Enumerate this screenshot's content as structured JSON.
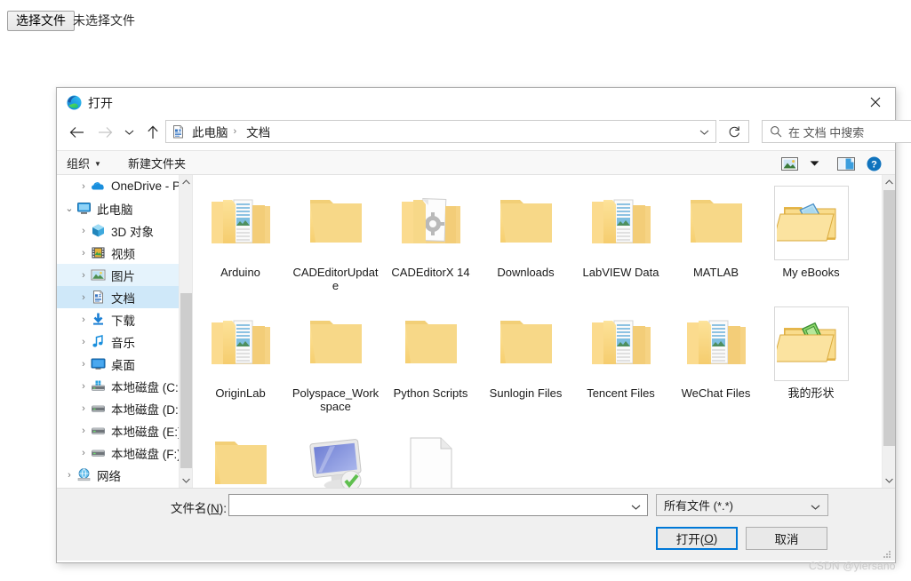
{
  "page": {
    "choose_file_button": "选择文件",
    "file_status": "未选择文件",
    "watermark": "CSDN @yiersano"
  },
  "dialog": {
    "title": "打开",
    "title_icon": "edge-logo-icon",
    "close_icon": "close-icon",
    "nav": {
      "back_icon": "arrow-left-icon",
      "forward_icon": "arrow-right-icon",
      "recent_icon": "chevron-down-icon",
      "up_icon": "arrow-up-icon",
      "address_icon": "documents-folder-icon",
      "breadcrumbs": [
        "此电脑",
        "文档"
      ],
      "breadcrumb_separator": "›",
      "address_chevron_icon": "chevron-down-icon",
      "refresh_icon": "refresh-icon",
      "search_icon": "search-icon",
      "search_placeholder": "在 文档 中搜索"
    },
    "toolbar": {
      "organize_label": "组织",
      "organize_caret": "▼",
      "new_folder_label": "新建文件夹",
      "view_icon": "view-options-icon",
      "view_caret_icon": "chevron-down-icon",
      "preview_pane_icon": "preview-pane-icon",
      "help_icon": "help-icon"
    },
    "sidebar": {
      "items": [
        {
          "label": "OneDrive - Pers",
          "icon": "onedrive-icon",
          "indent": 1,
          "expander": "›",
          "state": "none"
        },
        {
          "label": "此电脑",
          "icon": "this-pc-icon",
          "indent": 0,
          "expander": "⌄",
          "state": "none"
        },
        {
          "label": "3D 对象",
          "icon": "3d-objects-icon",
          "indent": 1,
          "expander": "›",
          "state": "none"
        },
        {
          "label": "视频",
          "icon": "videos-icon",
          "indent": 1,
          "expander": "›",
          "state": "none"
        },
        {
          "label": "图片",
          "icon": "pictures-icon",
          "indent": 1,
          "expander": "›",
          "state": "hover"
        },
        {
          "label": "文档",
          "icon": "documents-icon",
          "indent": 1,
          "expander": "›",
          "state": "selected"
        },
        {
          "label": "下载",
          "icon": "downloads-icon",
          "indent": 1,
          "expander": "›",
          "state": "none"
        },
        {
          "label": "音乐",
          "icon": "music-icon",
          "indent": 1,
          "expander": "›",
          "state": "none"
        },
        {
          "label": "桌面",
          "icon": "desktop-icon",
          "indent": 1,
          "expander": "›",
          "state": "none"
        },
        {
          "label": "本地磁盘 (C:)",
          "icon": "system-drive-icon",
          "indent": 1,
          "expander": "›",
          "state": "none"
        },
        {
          "label": "本地磁盘 (D:)",
          "icon": "drive-icon",
          "indent": 1,
          "expander": "›",
          "state": "none"
        },
        {
          "label": "本地磁盘 (E:)",
          "icon": "drive-icon",
          "indent": 1,
          "expander": "›",
          "state": "none"
        },
        {
          "label": "本地磁盘 (F:)",
          "icon": "drive-icon",
          "indent": 1,
          "expander": "›",
          "state": "none"
        },
        {
          "label": "网络",
          "icon": "network-icon",
          "indent": 0,
          "expander": "›",
          "state": "none"
        }
      ],
      "scrollbar": {
        "up_icon": "caret-up-icon",
        "down_icon": "caret-down-icon"
      }
    },
    "files": {
      "items": [
        {
          "name": "Arduino",
          "icon": "folder-with-contents-icon",
          "boxed": false
        },
        {
          "name": "CADEditorUpdate",
          "icon": "folder-icon",
          "boxed": false
        },
        {
          "name": "CADEditorX 14",
          "icon": "folder-with-gear-doc-icon",
          "boxed": false
        },
        {
          "name": "Downloads",
          "icon": "folder-icon",
          "boxed": false
        },
        {
          "name": "LabVIEW Data",
          "icon": "folder-with-contents-icon",
          "boxed": false
        },
        {
          "name": "MATLAB",
          "icon": "folder-icon",
          "boxed": false
        },
        {
          "name": "My eBooks",
          "icon": "open-folder-blue-shapes-icon",
          "boxed": true
        },
        {
          "name": "OriginLab",
          "icon": "folder-with-contents-icon",
          "boxed": false
        },
        {
          "name": "Polyspace_Workspace",
          "icon": "folder-icon",
          "boxed": false
        },
        {
          "name": "Python Scripts",
          "icon": "folder-icon",
          "boxed": false
        },
        {
          "name": "Sunlogin Files",
          "icon": "folder-icon",
          "boxed": false
        },
        {
          "name": "Tencent Files",
          "icon": "folder-with-contents-icon",
          "boxed": false
        },
        {
          "name": "WeChat Files",
          "icon": "folder-with-contents-icon",
          "boxed": false
        },
        {
          "name": "我的形状",
          "icon": "open-folder-green-shapes-icon",
          "boxed": true
        },
        {
          "name": "",
          "icon": "folder-icon",
          "boxed": false
        },
        {
          "name": "",
          "icon": "monitor-icon",
          "boxed": false
        },
        {
          "name": "",
          "icon": "document-page-icon",
          "boxed": false
        }
      ],
      "scrollbar": {
        "up_icon": "caret-up-icon",
        "down_icon": "caret-down-icon"
      }
    },
    "footer": {
      "filename_label_prefix": "文件名(",
      "filename_label_key": "N",
      "filename_label_suffix": "):",
      "filename_value": "",
      "filename_chevron_icon": "chevron-down-icon",
      "filter_value": "所有文件 (*.*)",
      "filter_chevron_icon": "chevron-down-icon",
      "open_label_prefix": "打开(",
      "open_label_key": "O",
      "open_label_suffix": ")",
      "cancel_label": "取消",
      "resize_grip_icon": "resize-grip-icon"
    }
  },
  "colors": {
    "accent": "#0078d7",
    "selection": "#cfe8f9",
    "hover": "#e5f3fc",
    "folder": "#ffd976",
    "toolbar_bg": "#f8f8f8",
    "footer_bg": "#f0f0f0"
  }
}
